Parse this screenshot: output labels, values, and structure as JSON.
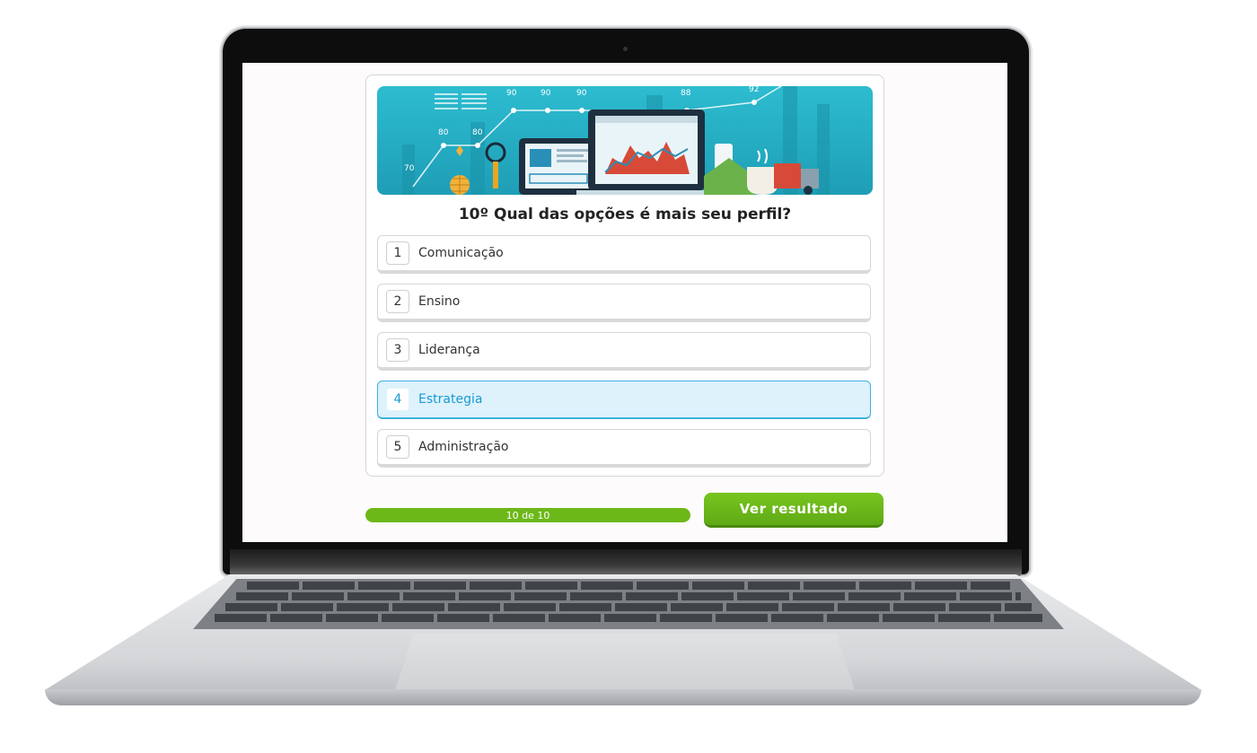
{
  "quiz": {
    "question": "10º Qual das opções é mais seu perfil?",
    "options": [
      {
        "number": "1",
        "label": "Comunicação"
      },
      {
        "number": "2",
        "label": "Ensino"
      },
      {
        "number": "3",
        "label": "Liderança"
      },
      {
        "number": "4",
        "label": "Estrategia"
      },
      {
        "number": "5",
        "label": "Administração"
      }
    ],
    "selected_option": "4",
    "progress": {
      "text": "10 de 10",
      "current": 10,
      "total": 10,
      "fraction": 1.0
    },
    "result_button_label": "Ver resultado"
  },
  "banner": {
    "chart_numbers": [
      "70",
      "80",
      "80",
      "90",
      "90",
      "90",
      "88",
      "92"
    ]
  },
  "colors": {
    "accent_green": "#6cb819",
    "selected_blue": "#3fb0e4",
    "banner_teal": "#2bb3c9"
  }
}
